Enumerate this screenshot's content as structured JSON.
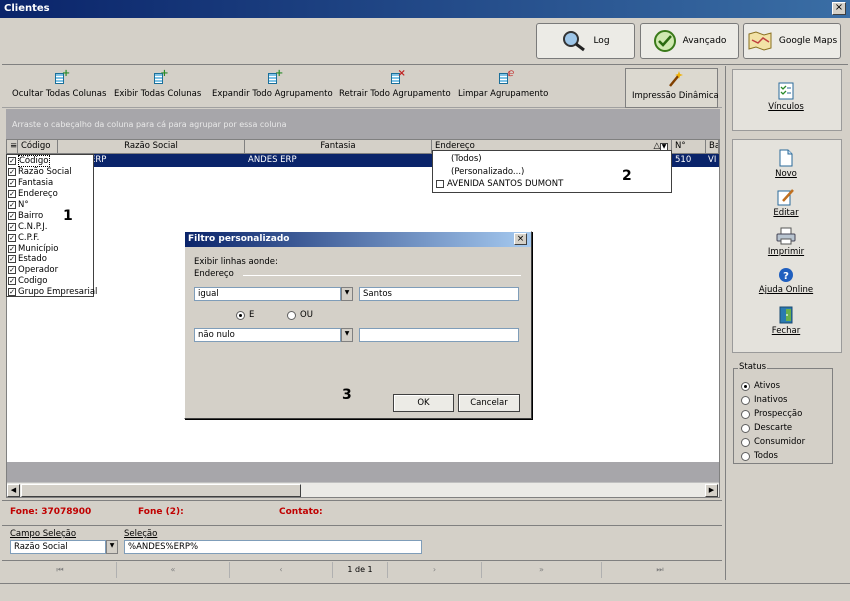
{
  "window": {
    "title": "Clientes",
    "close": "×"
  },
  "topbar": {
    "log": "Log",
    "avancado": "Avançado",
    "maps": "Google Maps"
  },
  "toolbar": {
    "ocultar": "Ocultar Todas Colunas",
    "exibir": "Exibir Todas Colunas",
    "expandir": "Expandir Todo Agrupamento",
    "retrair": "Retrair Todo Agrupamento",
    "limpar": "Limpar Agrupamento",
    "impressao": "Impressão Dinâmica"
  },
  "grid": {
    "group_hint": "Arraste o cabeçalho da coluna para cá para agrupar por essa coluna",
    "headers": {
      "codigo": "Código",
      "razao": "Razão Social",
      "fantasia": "Fantasia",
      "endereco": "Endereço",
      "numero": "N°",
      "bairro": "Ba"
    },
    "row": {
      "razao": "ERP",
      "fantasia": "ANDES ERP",
      "numero": "510",
      "bairro": "VI"
    }
  },
  "columns_panel": {
    "items": [
      "Código",
      "Razão Social",
      "Fantasia",
      "Endereço",
      "N°",
      "Bairro",
      "C.N.P.J.",
      "C.P.F.",
      "Município",
      "Estado",
      "Operador",
      "Codigo",
      "Grupo Empresarial"
    ]
  },
  "filter_dropdown": {
    "todos": "(Todos)",
    "personalizado": "(Personalizado...)",
    "value": "AVENIDA SANTOS DUMONT"
  },
  "markers": {
    "one": "1",
    "two": "2",
    "three": "3"
  },
  "dialog": {
    "title": "Filtro personalizado",
    "close": "×",
    "intro": "Exibir linhas aonde:",
    "field": "Endereço",
    "op1": "igual",
    "val1": "Santos",
    "and": "E",
    "or": "OU",
    "op2": "não nulo",
    "val2": "",
    "ok": "OK",
    "cancel": "Cancelar"
  },
  "phone": {
    "fone": "Fone: 37078900",
    "fone2": "Fone (2):",
    "contato": "Contato:"
  },
  "bottom": {
    "campo_label": "Campo Seleção",
    "campo_value": "Razão Social",
    "selecao_label": "Seleção",
    "selecao_value": "%ANDES%ERP%"
  },
  "nav": {
    "first": "⏮",
    "prev_page": "«",
    "prev": "‹",
    "page": "1 de 1",
    "next": "›",
    "next_page": "»",
    "last": "⏭"
  },
  "right": {
    "vinculos": "Vínculos",
    "novo": "Novo",
    "editar": "Editar",
    "imprimir": "Imprimir",
    "ajuda": "Ajuda Online",
    "fechar": "Fechar",
    "status_title": "Status",
    "status_options": [
      "Ativos",
      "Inativos",
      "Prospecção",
      "Descarte",
      "Consumidor",
      "Todos"
    ]
  }
}
